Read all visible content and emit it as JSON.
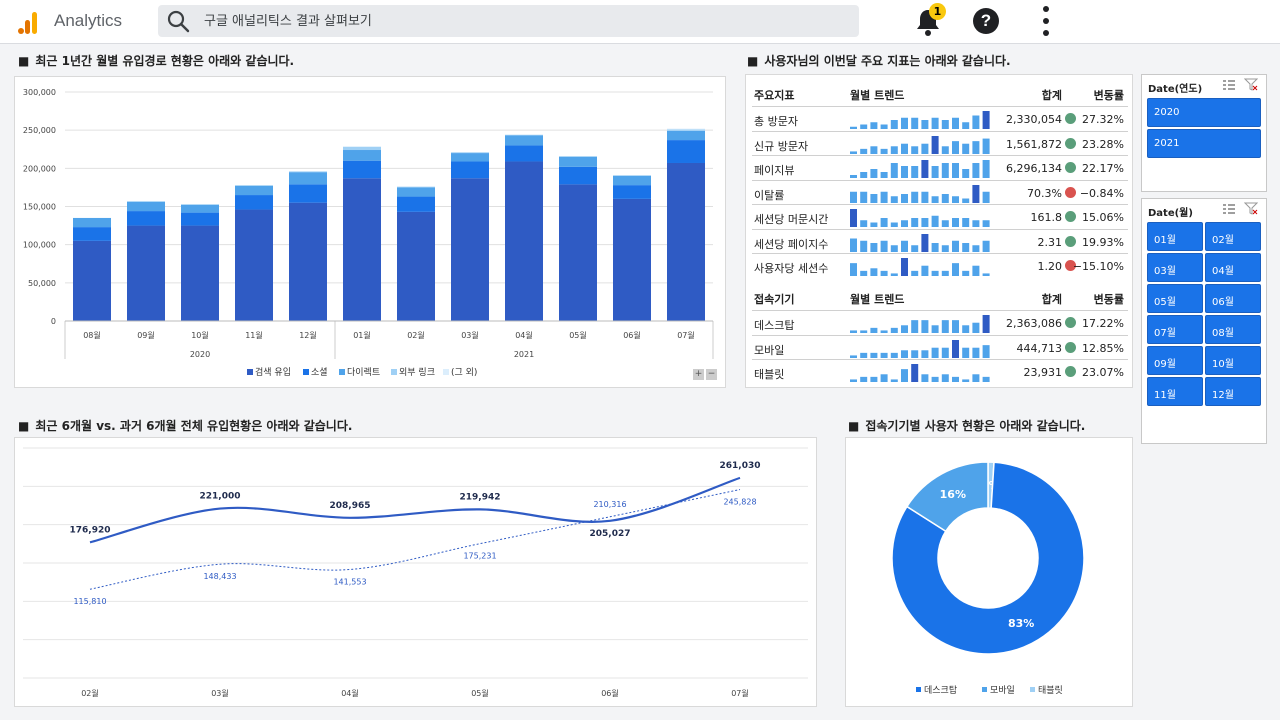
{
  "app": {
    "title": "Analytics"
  },
  "search": {
    "placeholder": "구글 애널리틱스 결과 살펴보기"
  },
  "notifications": {
    "count": "1"
  },
  "help": {
    "label": "?"
  },
  "sections": {
    "monthly": "최근 1년간 월별 유입경로 현황은 아래와 같습니다.",
    "kpi": "사용자님의 이번달 주요 지표는 아래와 같습니다.",
    "compare": "최근 6개월 vs. 과거 6개월 전체 유입현황은 아래와 같습니다.",
    "device": "접속기기별 사용자 현황은 아래와 같습니다."
  },
  "colors": {
    "search": "#2f5bc4",
    "social": "#1a73e8",
    "direct": "#4fa3ea",
    "external": "#9fd0f5",
    "other": "#dceefc",
    "positive": "#5a9e7a",
    "negative": "#d9534f",
    "recent": "#2f5bc4",
    "past": "#2f5bc4"
  },
  "kpi_table": {
    "headers": {
      "name": "주요지표",
      "trend": "월별 트렌드",
      "total": "합계",
      "change": "변동률"
    },
    "rows": [
      {
        "name": "총 방문자",
        "total": "2,330,054",
        "change": "27.32%",
        "status": "positive",
        "spark": [
          1,
          2,
          3,
          2,
          4,
          5,
          5,
          4,
          5,
          4,
          5,
          3,
          6,
          8
        ]
      },
      {
        "name": "신규 방문자",
        "total": "1,561,872",
        "change": "23.28%",
        "status": "positive",
        "spark": [
          1,
          2,
          3,
          2,
          3,
          4,
          3,
          4,
          7,
          3,
          5,
          4,
          5,
          6
        ]
      },
      {
        "name": "페이지뷰",
        "total": "6,296,134",
        "change": "22.17%",
        "status": "positive",
        "spark": [
          1,
          2,
          3,
          2,
          5,
          4,
          4,
          6,
          4,
          5,
          5,
          3,
          5,
          6
        ]
      },
      {
        "name": "이탈률",
        "total": "70.3%",
        "change": "−0.84%",
        "status": "negative",
        "spark": [
          5,
          5,
          4,
          5,
          3,
          4,
          5,
          5,
          3,
          4,
          3,
          2,
          8,
          5
        ]
      },
      {
        "name": "세션당 머문시간",
        "total": "161.8",
        "change": "15.06%",
        "status": "positive",
        "spark": [
          8,
          3,
          2,
          4,
          2,
          3,
          4,
          4,
          5,
          3,
          4,
          4,
          3,
          3
        ]
      },
      {
        "name": "세션당 페이지수",
        "total": "2.31",
        "change": "19.93%",
        "status": "positive",
        "spark": [
          6,
          5,
          4,
          5,
          3,
          5,
          3,
          8,
          4,
          3,
          5,
          4,
          3,
          5
        ]
      },
      {
        "name": "사용자당 세션수",
        "total": "1.20",
        "change": "−15.10%",
        "status": "negative",
        "spark": [
          5,
          2,
          3,
          2,
          1,
          7,
          2,
          4,
          2,
          2,
          5,
          2,
          4,
          1
        ]
      }
    ],
    "device_headers": {
      "name": "접속기기",
      "trend": "월별 트렌드",
      "total": "합계",
      "change": "변동률"
    },
    "device_rows": [
      {
        "name": "데스크탑",
        "total": "2,363,086",
        "change": "17.22%",
        "status": "positive",
        "spark": [
          1,
          1,
          2,
          1,
          2,
          3,
          5,
          5,
          3,
          5,
          5,
          3,
          4,
          7
        ]
      },
      {
        "name": "모바일",
        "total": "444,713",
        "change": "12.85%",
        "status": "positive",
        "spark": [
          1,
          2,
          2,
          2,
          2,
          3,
          3,
          3,
          4,
          4,
          7,
          4,
          4,
          5
        ]
      },
      {
        "name": "태블릿",
        "total": "23,931",
        "change": "23.07%",
        "status": "positive",
        "spark": [
          1,
          2,
          2,
          3,
          1,
          5,
          7,
          3,
          2,
          3,
          2,
          1,
          3,
          2
        ]
      }
    ]
  },
  "slicers": {
    "year": {
      "title": "Date(연도)",
      "options": [
        "2020",
        "2021"
      ]
    },
    "month": {
      "title": "Date(월)",
      "options": [
        "01월",
        "02월",
        "03월",
        "04월",
        "05월",
        "06월",
        "07월",
        "08월",
        "09월",
        "10월",
        "11월",
        "12월"
      ]
    }
  },
  "chart_data": [
    {
      "type": "bar",
      "stacked": true,
      "categories": [
        "08월",
        "09월",
        "10월",
        "11월",
        "12월",
        "01월",
        "02월",
        "03월",
        "04월",
        "05월",
        "06월",
        "07월"
      ],
      "groups": [
        {
          "label": "2020",
          "count": 5
        },
        {
          "label": "2021",
          "count": 7
        }
      ],
      "series": [
        {
          "name": "검색 유입",
          "color_key": "search",
          "values": [
            105000,
            125000,
            125000,
            146000,
            155000,
            187000,
            143000,
            187000,
            209000,
            179000,
            160000,
            207000
          ]
        },
        {
          "name": "소셜",
          "color_key": "social",
          "values": [
            18000,
            19000,
            17000,
            19000,
            24000,
            23000,
            20000,
            22000,
            21000,
            23000,
            18000,
            30000
          ]
        },
        {
          "name": "다이렉트",
          "color_key": "direct",
          "values": [
            12000,
            12000,
            10000,
            12000,
            16000,
            14000,
            12000,
            11000,
            13000,
            13000,
            12000,
            12000
          ]
        },
        {
          "name": "외부 링크",
          "color_key": "external",
          "values": [
            0,
            1000,
            1000,
            1000,
            1000,
            4000,
            1000,
            1000,
            1000,
            1000,
            1000,
            2000
          ]
        },
        {
          "name": "(그 외)",
          "color_key": "other",
          "values": [
            0,
            0,
            0,
            0,
            0,
            1000,
            0,
            0,
            0,
            0,
            0,
            1000
          ]
        }
      ],
      "ylim": [
        0,
        300000
      ],
      "yticks": [
        "0",
        "50,000",
        "100,000",
        "150,000",
        "200,000",
        "250,000",
        "300,000"
      ],
      "legend": "bottom",
      "grid": true
    },
    {
      "type": "line",
      "categories": [
        "02월",
        "03월",
        "04월",
        "05월",
        "06월",
        "07월"
      ],
      "series": [
        {
          "color_key": "recent",
          "style": "solid",
          "values": [
            176920,
            221000,
            208965,
            219942,
            205027,
            261030
          ],
          "labels": [
            "176,920",
            "221,000",
            "208,965",
            "219,942",
            "205,027",
            "261,030"
          ]
        },
        {
          "color_key": "past",
          "style": "dotted",
          "values": [
            115810,
            148433,
            141553,
            175231,
            210316,
            245828
          ],
          "labels": [
            "115,810",
            "148,433",
            "141,553",
            "175,231",
            "210,316",
            "245,828"
          ]
        }
      ],
      "ylim": [
        0,
        300000
      ],
      "grid": true
    },
    {
      "type": "pie",
      "donut": true,
      "slices": [
        {
          "name": "데스크탑",
          "value": 83,
          "label": "83%",
          "color": "#1a73e8"
        },
        {
          "name": "모바일",
          "value": 16,
          "label": "16%",
          "color": "#4fa3ea"
        },
        {
          "name": "태블릿",
          "value": 1,
          "label": "1%",
          "color": "#9fd0f5"
        }
      ],
      "legend": "bottom"
    }
  ]
}
